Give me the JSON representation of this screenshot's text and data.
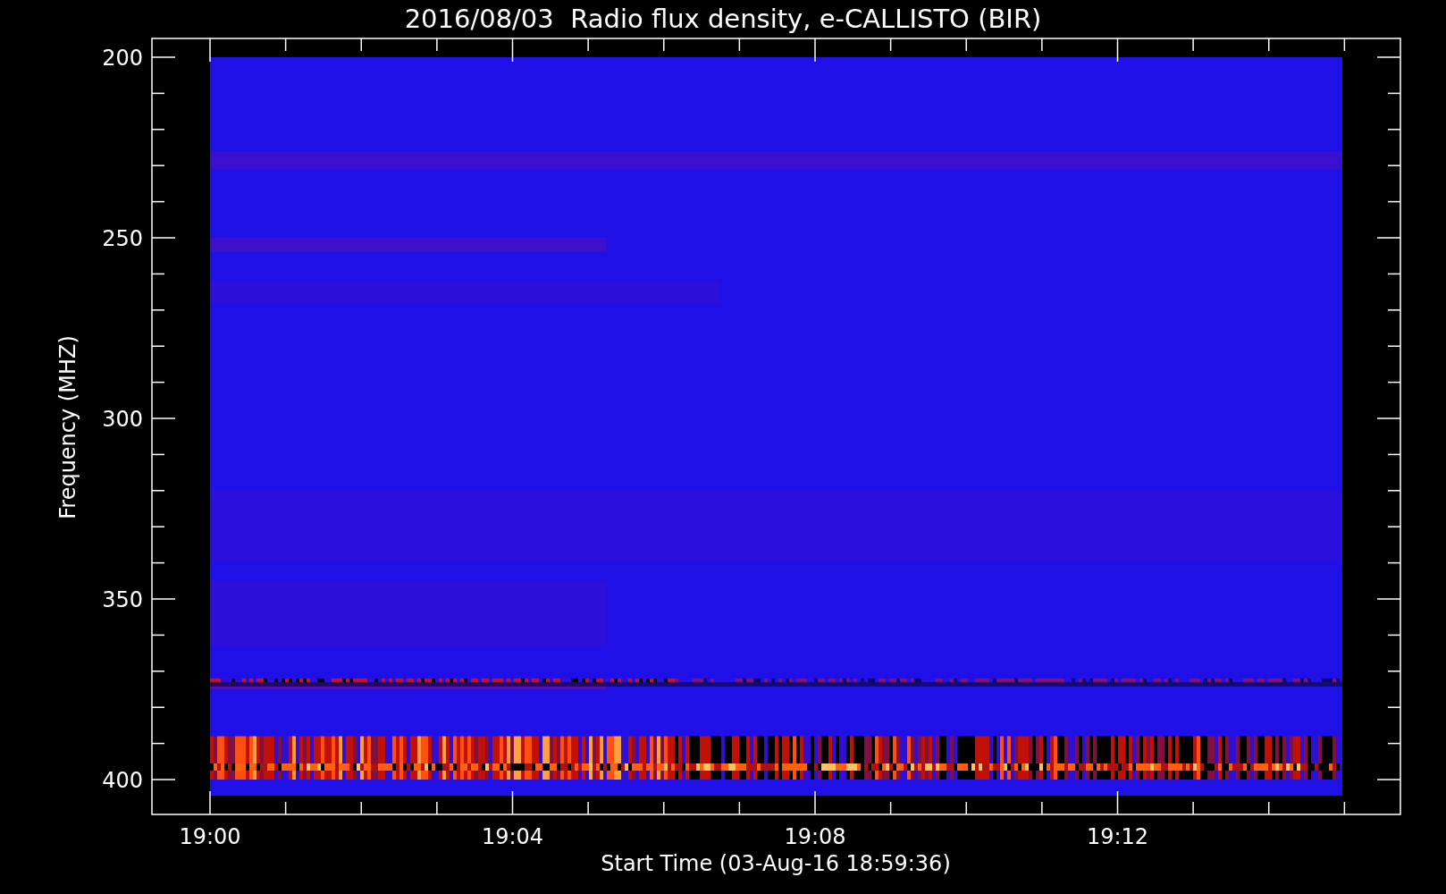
{
  "title": "2016/08/03  Radio flux density, e-CALLISTO (BIR)",
  "y_axis": {
    "label": "Frequency (MHZ)",
    "ticks": [
      "200",
      "250",
      "300",
      "350",
      "400"
    ]
  },
  "x_axis": {
    "label": "Start Time (03-Aug-16 18:59:36)",
    "ticks": [
      "19:00",
      "19:04",
      "19:08",
      "19:12"
    ]
  }
}
